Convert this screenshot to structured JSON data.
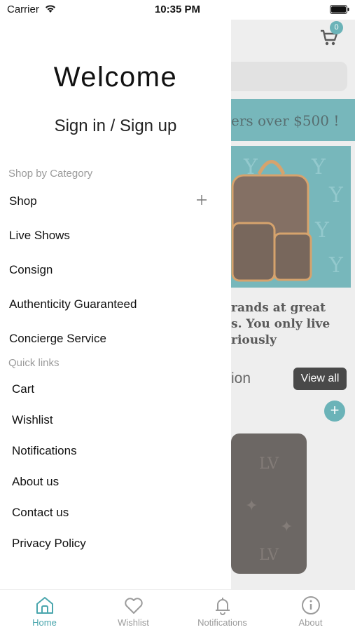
{
  "status_bar": {
    "carrier": "Carrier",
    "time": "10:35 PM"
  },
  "background": {
    "cart_count": "0",
    "promo_text": "ers over $500 !",
    "tagline_lines": [
      "rands at great",
      "s. You only live",
      "riously"
    ],
    "section_title": "ion",
    "view_all_label": "View all",
    "add_label": "+"
  },
  "drawer": {
    "welcome": "Welcome",
    "sign_in": "Sign in / Sign up",
    "shop_by_category": "Shop by Category",
    "categories": [
      {
        "label": "Shop"
      },
      {
        "label": "Live Shows"
      },
      {
        "label": "Consign"
      },
      {
        "label": "Authenticity Guaranteed"
      },
      {
        "label": "Concierge Service"
      }
    ],
    "quick_links_heading": "Quick links",
    "quick_links": [
      {
        "label": "Cart"
      },
      {
        "label": "Wishlist"
      },
      {
        "label": "Notifications"
      },
      {
        "label": "About us"
      },
      {
        "label": "Contact us"
      },
      {
        "label": "Privacy Policy"
      }
    ]
  },
  "tab_bar": {
    "tabs": [
      {
        "label": "Home",
        "icon": "home-icon",
        "active": true
      },
      {
        "label": "Wishlist",
        "icon": "heart-icon",
        "active": false
      },
      {
        "label": "Notifications",
        "icon": "bell-icon",
        "active": false
      },
      {
        "label": "About",
        "icon": "info-icon",
        "active": false
      }
    ]
  },
  "colors": {
    "accent": "#4aa6ad",
    "promo_teal": "#4a9fa5",
    "inactive_tab": "#9b9b9b"
  }
}
